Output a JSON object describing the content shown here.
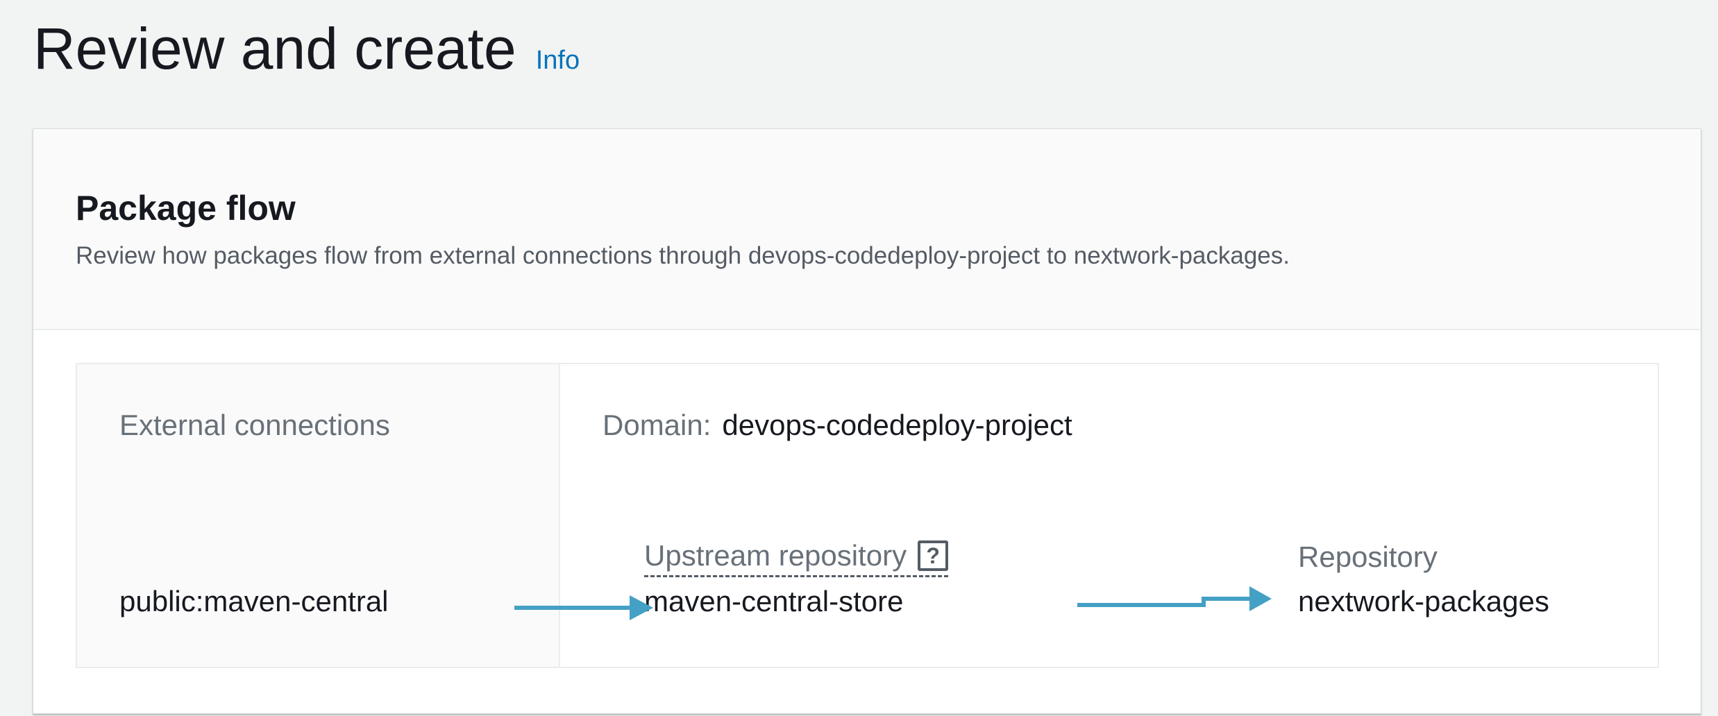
{
  "header": {
    "title": "Review and create",
    "info_link": "Info"
  },
  "package_flow": {
    "title": "Package flow",
    "description": "Review how packages flow from external connections through devops-codedeploy-project to nextwork-packages.",
    "external_connections": {
      "heading": "External connections",
      "value": "public:maven-central"
    },
    "domain": {
      "label": "Domain:",
      "value": "devops-codedeploy-project"
    },
    "upstream_repository": {
      "heading": "Upstream repository",
      "help_icon": "?",
      "value": "maven-central-store"
    },
    "repository": {
      "heading": "Repository",
      "value": "nextwork-packages"
    }
  },
  "colors": {
    "arrow": "#44a0c4",
    "link": "#0073bb",
    "background": "#f2f3f3"
  }
}
